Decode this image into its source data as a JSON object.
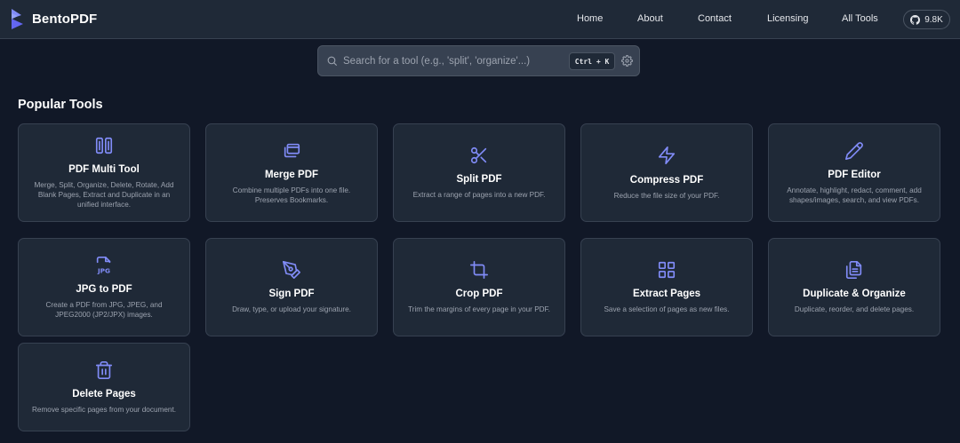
{
  "brand": {
    "name": "BentoPDF"
  },
  "nav": {
    "links": [
      "Home",
      "About",
      "Contact",
      "Licensing",
      "All Tools"
    ],
    "github_stars": "9.8K"
  },
  "search": {
    "placeholder": "Search for a tool (e.g., 'split', 'organize'...)",
    "value": "",
    "shortcut": "Ctrl + K"
  },
  "section": {
    "title": "Popular Tools"
  },
  "tools": [
    {
      "title": "PDF Multi Tool",
      "icon": "columns-icon",
      "desc": "Merge, Split, Organize, Delete, Rotate, Add Blank Pages, Extract and Duplicate in an unified interface."
    },
    {
      "title": "Merge PDF",
      "icon": "copy-icon",
      "desc": "Combine multiple PDFs into one file. Preserves Bookmarks."
    },
    {
      "title": "Split PDF",
      "icon": "scissors-icon",
      "desc": "Extract a range of pages into a new PDF."
    },
    {
      "title": "Compress PDF",
      "icon": "zap-icon",
      "desc": "Reduce the file size of your PDF."
    },
    {
      "title": "PDF Editor",
      "icon": "pencil-icon",
      "desc": "Annotate, highlight, redact, comment, add shapes/images, search, and view PDFs."
    },
    {
      "title": "JPG to PDF",
      "icon": "jpg-file-icon",
      "desc": "Create a PDF from JPG, JPEG, and JPEG2000 (JP2/JPX) images."
    },
    {
      "title": "Sign PDF",
      "icon": "pen-nib-icon",
      "desc": "Draw, type, or upload your signature."
    },
    {
      "title": "Crop PDF",
      "icon": "crop-icon",
      "desc": "Trim the margins of every page in your PDF."
    },
    {
      "title": "Extract Pages",
      "icon": "grid-icon",
      "desc": "Save a selection of pages as new files."
    },
    {
      "title": "Duplicate & Organize",
      "icon": "files-icon",
      "desc": "Duplicate, reorder, and delete pages."
    },
    {
      "title": "Delete Pages",
      "icon": "trash-icon",
      "desc": "Remove specific pages from your document."
    }
  ],
  "colors": {
    "accent": "#818cf8",
    "background": "#111827",
    "card": "#1f2937",
    "border": "#374151"
  }
}
